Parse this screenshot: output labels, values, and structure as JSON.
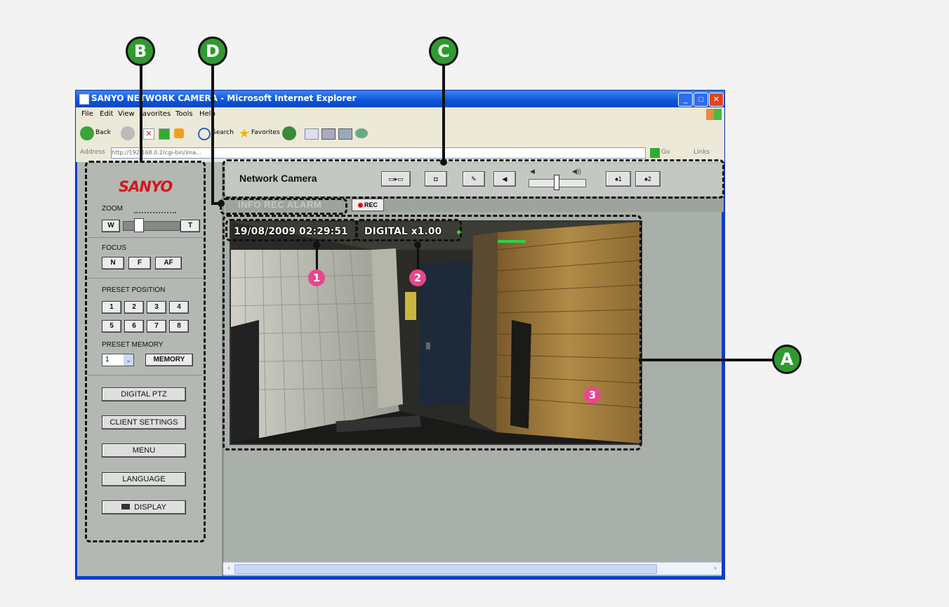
{
  "window": {
    "title": "SANYO NETWORK CAMERA - Microsoft Internet Explorer",
    "controls": [
      "_",
      "□",
      "✕"
    ]
  },
  "menu": [
    "File",
    "Edit",
    "View",
    "Favorites",
    "Tools",
    "Help"
  ],
  "toolbar": {
    "back": "Back",
    "search": "Search",
    "favorites": "Favorites"
  },
  "address": {
    "label": "Address",
    "url": "http://192.168.0.2/cgi-bin/ima...",
    "go": "Go",
    "links": "Links"
  },
  "camera": {
    "title": "Network Camera",
    "buttons": [
      "▭▸▭",
      "◘",
      "✎",
      "◀",
      "♠1",
      "♠2"
    ],
    "volume_low": "◀",
    "volume_high": "◀))",
    "info_tab": "INFO REC ALARM",
    "rec": "REC"
  },
  "video": {
    "timestamp": "19/08/2009 02:29:51",
    "zoom": "DIGITAL x1.00"
  },
  "panel": {
    "logo": "SANYO",
    "zoom_label": "ZOOM",
    "zoom_w": "W",
    "zoom_t": "T",
    "focus_label": "FOCUS",
    "focus_n": "N",
    "focus_f": "F",
    "focus_af": "AF",
    "preset_position_label": "PRESET POSITION",
    "presets": [
      "1",
      "2",
      "3",
      "4",
      "5",
      "6",
      "7",
      "8"
    ],
    "preset_memory_label": "PRESET MEMORY",
    "preset_select": "1",
    "memory_btn": "MEMORY",
    "digital_ptz": "DIGITAL PTZ",
    "client_settings": "CLIENT SETTINGS",
    "menu": "MENU",
    "language": "LANGUAGE",
    "display": "DISPLAY"
  },
  "annotations": {
    "A": "A",
    "B": "B",
    "C": "C",
    "D": "D",
    "n1": "1",
    "n2": "2",
    "n3": "3"
  },
  "colors": {
    "callout_green": "#2f9a2f",
    "number_pink": "#e8468e",
    "xp_blue": "#0b54d9",
    "sanyo_red": "#d8141c"
  }
}
